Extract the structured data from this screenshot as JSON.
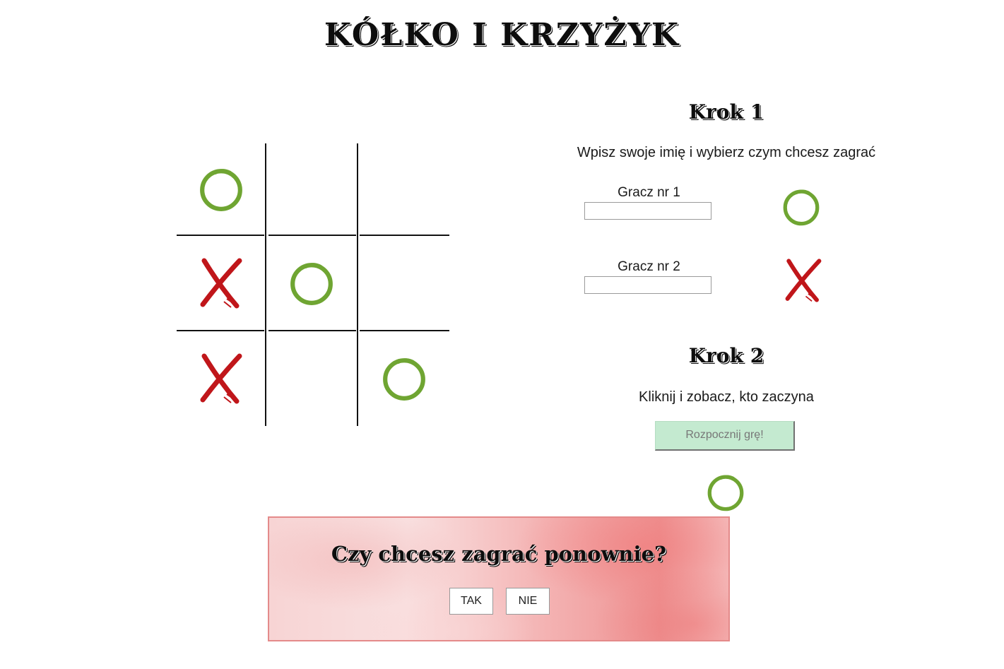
{
  "title": "KÓŁKO I KRZYŻYK",
  "board": {
    "cells": [
      "O",
      "",
      "",
      "X",
      "O",
      "",
      "X",
      "",
      "O"
    ]
  },
  "step1": {
    "title": "Krok 1",
    "instruction": "Wpisz swoje imię i wybierz czym chcesz zagrać",
    "player1": {
      "label": "Gracz nr 1",
      "value": "",
      "symbol": "O"
    },
    "player2": {
      "label": "Gracz nr 2",
      "value": "",
      "symbol": "X"
    }
  },
  "step2": {
    "title": "Krok 2",
    "instruction": "Kliknij i zobacz, kto zaczyna",
    "start_label": "Rozpocznij grę!",
    "current_symbol": "O"
  },
  "modal": {
    "question": "Czy chcesz zagrać ponownie?",
    "yes_label": "TAK",
    "no_label": "NIE"
  },
  "colors": {
    "circle": "#6fa532",
    "cross": "#c0161a",
    "start_button": "#c4ead0",
    "modal_border": "#e48a8a"
  },
  "icons": {
    "O": "green-circle-icon",
    "X": "red-cross-icon"
  }
}
